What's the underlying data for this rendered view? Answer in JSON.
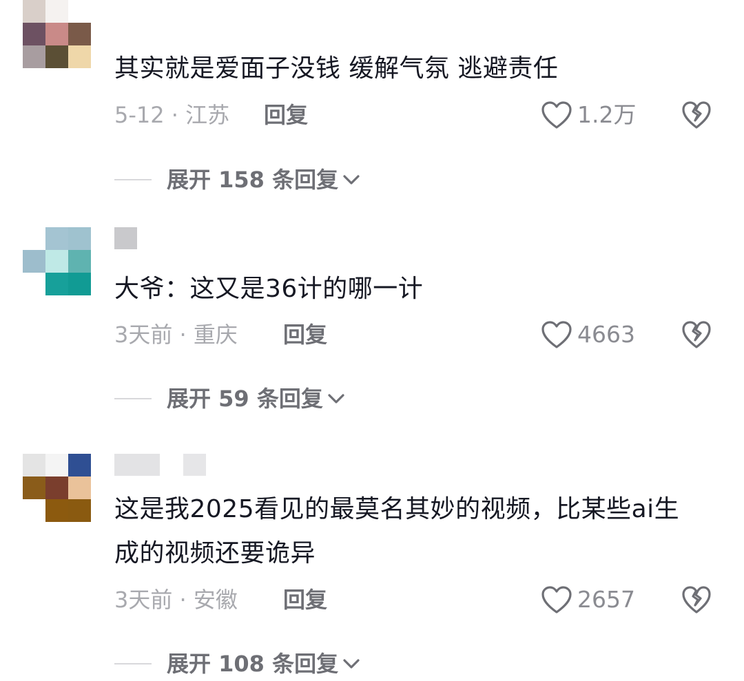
{
  "colors": {
    "text": "#161823",
    "meta": "#a8a9ae",
    "action": "#6e6f75",
    "icon": "#6e6f75"
  },
  "comments": [
    {
      "avatar_pixels": [
        "#d9cfc9",
        "#f5f2f0",
        "#ffffff",
        "#6d5162",
        "#c98a88",
        "#7a5a49",
        "#a89da0",
        "#5b4f35",
        "#efd7a9"
      ],
      "username_blocks": [
        1
      ],
      "text": "其实就是爱面子没钱 缓解气氛 逃避责任",
      "date": "5-12",
      "location": "江苏",
      "reply_label": "回复",
      "like_count": "1.2万",
      "expand_label": "展开 158 条回复"
    },
    {
      "avatar_pixels": [
        "#ffffff",
        "#a4c4d2",
        "#9fc2cf",
        "#9dbdcc",
        "#bfe9e6",
        "#5fb3b0",
        "#ffffff",
        "#17a09a",
        "#119b94"
      ],
      "username_blocks": [
        1
      ],
      "text": "大爷：这又是36计的哪一计",
      "date": "3天前",
      "location": "重庆",
      "reply_label": "回复",
      "like_count": "4663",
      "expand_label": "展开 59 条回复"
    },
    {
      "avatar_pixels": [
        "#e4e4e4",
        "#f4f4f4",
        "#2f4f93",
        "#8a5c1a",
        "#7a3e2d",
        "#eac29a",
        "#ffffff",
        "#8c5a0f",
        "#8a5a10"
      ],
      "username_blocks": [
        2
      ],
      "text": "这是我2025看见的最莫名其妙的视频，比某些ai生成的视频还要诡异",
      "date": "3天前",
      "location": "安徽",
      "reply_label": "回复",
      "like_count": "2657",
      "expand_label": "展开 108 条回复"
    }
  ]
}
